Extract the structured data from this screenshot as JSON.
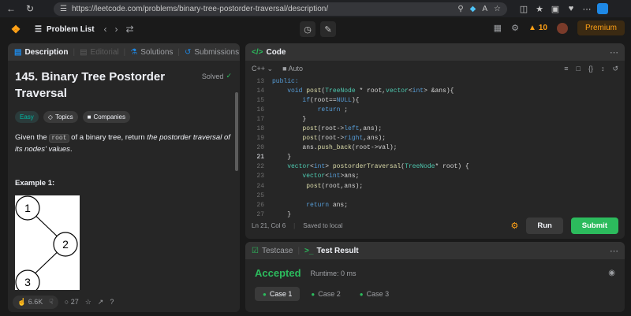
{
  "browser": {
    "url": "https://leetcode.com/problems/binary-tree-postorder-traversal/description/"
  },
  "nav": {
    "problem_list": "Problem List",
    "streak": "10",
    "premium": "Premium"
  },
  "left": {
    "tabs": [
      "Description",
      "Editorial",
      "Solutions",
      "Submissions"
    ],
    "title": "145. Binary Tree Postorder Traversal",
    "solved": "Solved",
    "tags": [
      "Easy",
      "Topics",
      "Companies"
    ],
    "desc_pre": "Given the ",
    "desc_code": "root",
    "desc_mid": " of a binary tree, return ",
    "desc_em": "the postorder traversal of its nodes' values",
    "desc_post": ".",
    "example_title": "Example 1:",
    "tree_nodes": [
      "1",
      "2",
      "3"
    ],
    "likes": "6.6K",
    "comments": "27"
  },
  "code": {
    "tab": "Code",
    "lang": "C++",
    "auto": "Auto",
    "status_pos": "Ln 21, Col 6",
    "status_saved": "Saved to local",
    "run": "Run",
    "submit": "Submit",
    "current_line": 21
  },
  "result": {
    "tabs": [
      "Testcase",
      "Test Result"
    ],
    "status": "Accepted",
    "runtime": "Runtime: 0 ms",
    "cases": [
      "Case 1",
      "Case 2",
      "Case 3"
    ]
  }
}
